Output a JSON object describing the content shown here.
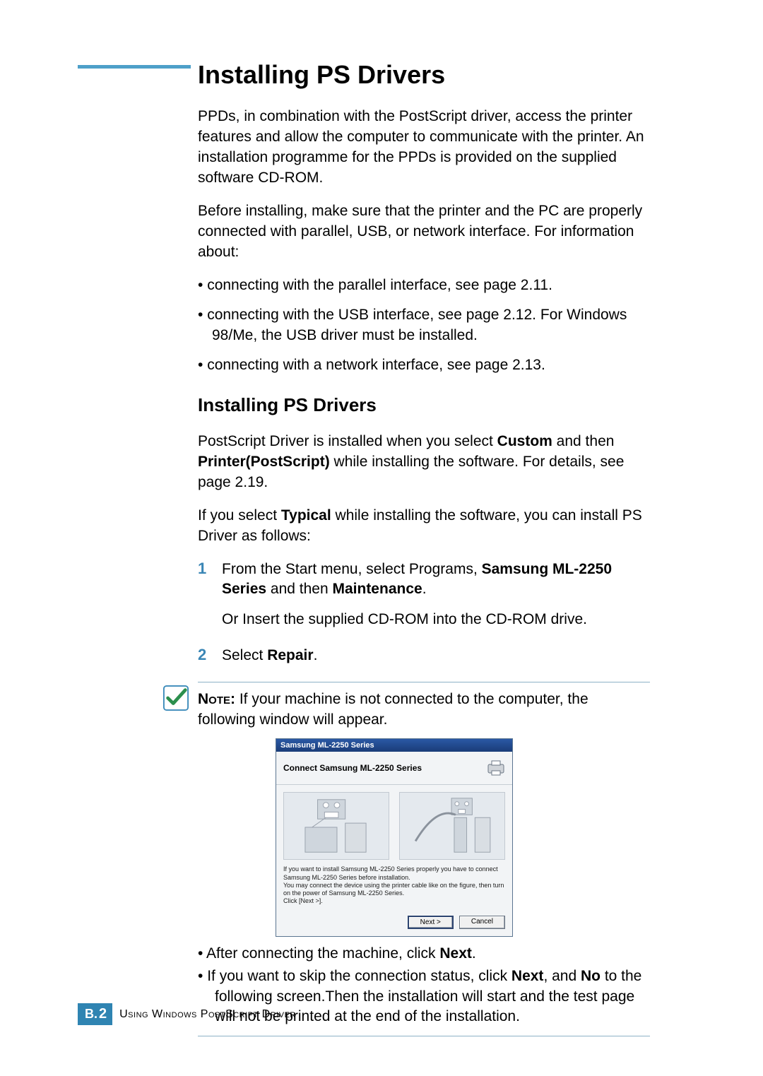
{
  "header": {
    "title": "Installing PS Drivers"
  },
  "intro": {
    "p1": "PPDs, in combination with the PostScript driver, access the printer features and allow the computer to communicate with the printer. An installation programme for the PPDs is provided on the supplied software CD-ROM.",
    "p2": "Before installing, make sure that the printer and the PC are properly connected with parallel, USB, or network interface. For information about:"
  },
  "bullets": [
    "connecting with the parallel interface, see page 2.11.",
    "connecting with the USB interface, see page 2.12. For Windows 98/Me, the USB driver must be installed.",
    "connecting with a network interface, see page 2.13."
  ],
  "sub": {
    "title": "Installing PS Drivers",
    "p1_a": "PostScript Driver is installed when you select ",
    "custom": "Custom",
    "p1_b": " and then ",
    "printer_ps": "Printer(PostScript)",
    "p1_c": " while installing the software. For details, see page 2.19.",
    "p2_a": "If you select ",
    "typical": "Typical",
    "p2_b": " while installing the software, you can install PS Driver as follows:"
  },
  "steps": {
    "s1": {
      "num": "1",
      "a": "From the Start menu, select Programs, ",
      "bold1": "Samsung ML-2250 Series",
      "b": " and then ",
      "bold2": "Maintenance",
      "c": ".",
      "d": "Or Insert the supplied CD-ROM into the CD-ROM drive."
    },
    "s2": {
      "num": "2",
      "a": "Select ",
      "bold": "Repair",
      "b": "."
    }
  },
  "note": {
    "label": "Note:",
    "text": " If your machine is not connected to the computer, the following window will appear.",
    "bul1_a": "After connecting the machine, click ",
    "bul1_bold": "Next",
    "bul1_b": ".",
    "bul2_a": "If you want to skip the connection status, click ",
    "bul2_bold1": "Next",
    "bul2_b": ", and ",
    "bul2_bold2": "No",
    "bul2_c": " to the following screen.Then the installation will start and the test page will not be printed at the end of the installation."
  },
  "dialog": {
    "titlebar": "Samsung ML-2250 Series",
    "hdr": "Connect Samsung ML-2250 Series",
    "msg1": "If you want to install Samsung ML-2250 Series properly you have to connect Samsung ML-2250 Series before installation.",
    "msg2": "You may connect the device using the printer cable like on the figure, then turn on the power of Samsung ML-2250 Series.",
    "msg3": "Click [Next >].",
    "btnNext": "Next >",
    "btnCancel": "Cancel"
  },
  "footer": {
    "letter": "B.",
    "num": "2",
    "text": "Using Windows PostScript Driver"
  }
}
